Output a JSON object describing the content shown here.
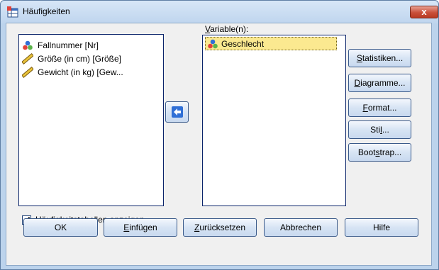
{
  "window": {
    "title": "Häufigkeiten",
    "close_label": "x"
  },
  "source_list": {
    "items": [
      {
        "label": "Fallnummer [Nr]",
        "icon": "nominal-variable-icon"
      },
      {
        "label": "Größe (in cm) [Größe]",
        "icon": "scale-ruler-icon"
      },
      {
        "label": "Gewicht (in kg) [Gew...",
        "icon": "scale-ruler-icon"
      }
    ]
  },
  "target_list": {
    "label": "Variable(n):",
    "items": [
      {
        "label": "Geschlecht",
        "icon": "nominal-variable-icon"
      }
    ]
  },
  "side_buttons": [
    {
      "pre": "",
      "u": "S",
      "post": "tatistiken..."
    },
    {
      "pre": "",
      "u": "D",
      "post": "iagramme..."
    },
    {
      "pre": "",
      "u": "F",
      "post": "ormat..."
    },
    {
      "pre": "Sti",
      "u": "l",
      "post": "..."
    },
    {
      "pre": "Boot",
      "u": "s",
      "post": "trap..."
    }
  ],
  "checkbox": {
    "pre": "Häufigkeits",
    "u": "t",
    "post": "abellen anzeigen",
    "checked": true
  },
  "bottom_buttons": [
    {
      "pre": "OK",
      "u": "",
      "post": ""
    },
    {
      "pre": "",
      "u": "E",
      "post": "infügen"
    },
    {
      "pre": "",
      "u": "Z",
      "post": "urücksetzen"
    },
    {
      "pre": "Abbrechen",
      "u": "",
      "post": ""
    },
    {
      "pre": "Hilfe",
      "u": "",
      "post": ""
    }
  ]
}
